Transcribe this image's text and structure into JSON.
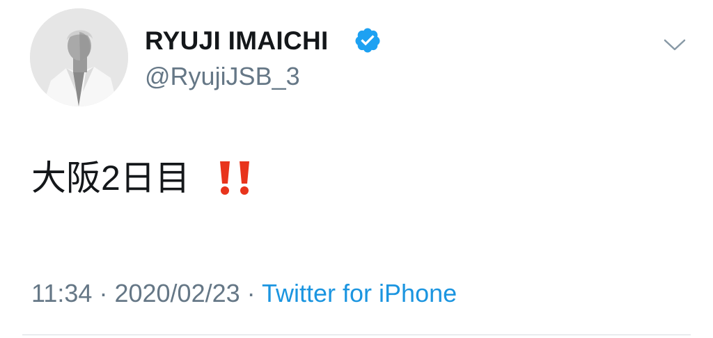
{
  "user": {
    "display_name": "RYUJI IMAICHI",
    "handle": "@RyujiJSB_3",
    "verified": true
  },
  "tweet": {
    "text": "大阪2日目",
    "emoji": "‼️"
  },
  "meta": {
    "time": "11:34",
    "separator": "·",
    "date": "2020/02/23",
    "source": "Twitter for iPhone"
  },
  "icons": {
    "verified": "verified-badge-icon",
    "menu": "chevron-down-icon",
    "emoji": "double-exclamation-icon"
  },
  "colors": {
    "text": "#14171a",
    "secondary": "#657786",
    "link": "#1b95e0",
    "verified": "#1da1f2",
    "emoji": "#e8341c"
  }
}
